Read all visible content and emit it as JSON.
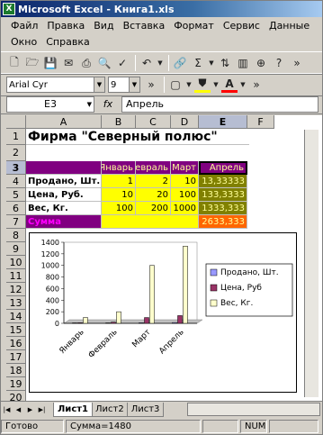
{
  "window": {
    "title": "Microsoft Excel - Книга1.xls"
  },
  "menu": {
    "row1": [
      "Файл",
      "Правка",
      "Вид",
      "Вставка",
      "Формат",
      "Сервис",
      "Данные"
    ],
    "row2": [
      "Окно",
      "Справка"
    ]
  },
  "format": {
    "font": "Arial Cyr",
    "size": "9"
  },
  "formula": {
    "cell": "E3",
    "fx": "fx",
    "value": "Апрель"
  },
  "columns": [
    "A",
    "B",
    "C",
    "D",
    "E",
    "F"
  ],
  "rows": [
    "1",
    "2",
    "3",
    "4",
    "5",
    "6",
    "7",
    "8",
    "9",
    "10",
    "11",
    "12",
    "13",
    "14",
    "15",
    "16",
    "17",
    "18",
    "19",
    "20"
  ],
  "sheet": {
    "title": "Фирма \"Северный полюс\"",
    "headers": [
      "Январь",
      "Февраль",
      "Март",
      "Апрель"
    ],
    "labels": [
      "Продано, Шт.",
      "Цена, Руб.",
      "Вес, Кг."
    ],
    "values": [
      [
        "1",
        "2",
        "10",
        "13,33333"
      ],
      [
        "10",
        "20",
        "100",
        "133,3333"
      ],
      [
        "100",
        "200",
        "1000",
        "1333,333"
      ]
    ],
    "sum_label": "Сумма",
    "sum_value": "2633,333"
  },
  "chart_data": {
    "type": "bar",
    "categories": [
      "Январь",
      "Февраль",
      "Март",
      "Апрель"
    ],
    "series": [
      {
        "name": "Продано, Шт.",
        "values": [
          1,
          2,
          10,
          13.33333
        ],
        "color": "#9999ff"
      },
      {
        "name": "Цена, Руб",
        "values": [
          10,
          20,
          100,
          133.3333
        ],
        "color": "#993366"
      },
      {
        "name": "Вес, Кг.",
        "values": [
          100,
          200,
          1000,
          1333.333
        ],
        "color": "#ffffcc"
      }
    ],
    "ylim": [
      0,
      1400
    ],
    "yticks": [
      "0",
      "200",
      "400",
      "600",
      "800",
      "1000",
      "1200",
      "1400"
    ],
    "legend": "right"
  },
  "tabs": [
    "Лист1",
    "Лист2",
    "Лист3"
  ],
  "status": {
    "mode": "Готово",
    "sum": "Сумма=1480",
    "num": "NUM"
  },
  "colors": {
    "purple": "#800080",
    "yellow": "#ffff00",
    "olive": "#808000",
    "orange": "#ff6600"
  }
}
